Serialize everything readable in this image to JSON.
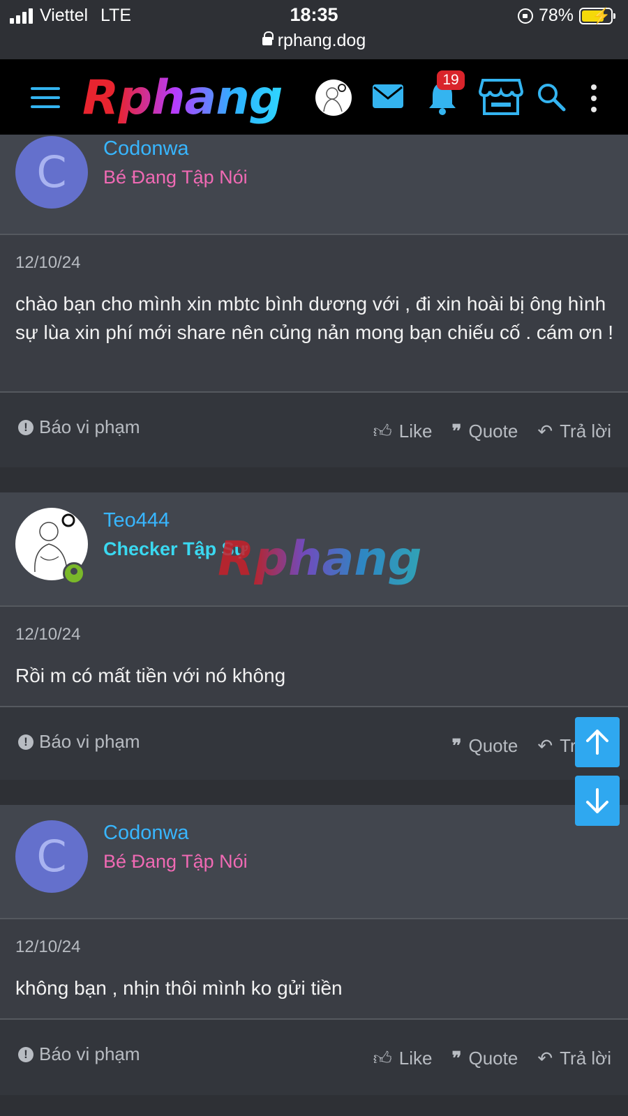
{
  "status_bar": {
    "carrier": "Viettel",
    "network": "LTE",
    "time": "18:35",
    "url": "rphang.dog",
    "battery": "78%"
  },
  "nav": {
    "logo_first": "R",
    "logo_rest": "phang",
    "notification_count": "19"
  },
  "posts": [
    {
      "username": "Codonwa",
      "user_title": "Bé Đang Tập Nói",
      "avatar_letter": "C",
      "date": "12/10/24",
      "body": "chào bạn cho mình xin mbtc bình dương với , đi xin hoài bị ông hình sự lùa xin phí mới share nên củng nản mong bạn chiếu cố . cám ơn !",
      "report": "Báo vi phạm",
      "like": "Like",
      "quote": "Quote",
      "reply": "Trả lời"
    },
    {
      "username": "Teo444",
      "user_title": "Checker Tập Sự",
      "date": "12/10/24",
      "body": "Rồi m có mất tiền với nó không",
      "report": "Báo vi phạm",
      "quote": "Quote",
      "reply": "Trả lời"
    },
    {
      "username": "Codonwa",
      "user_title": "Bé Đang Tập Nói",
      "avatar_letter": "C",
      "date": "12/10/24",
      "body": "không bạn , nhịn thôi mình ko gửi tiền",
      "report": "Báo vi phạm",
      "like": "Like",
      "quote": "Quote",
      "reply": "Trả lời"
    }
  ],
  "watermark": {
    "first": "R",
    "rest": "phang"
  },
  "colors": {
    "accent": "#38b6ff",
    "pink_title": "#f06ab4",
    "cyan_title": "#3ad8f0",
    "badge": "#d9242b",
    "scroll_button": "#2fa8f0"
  }
}
